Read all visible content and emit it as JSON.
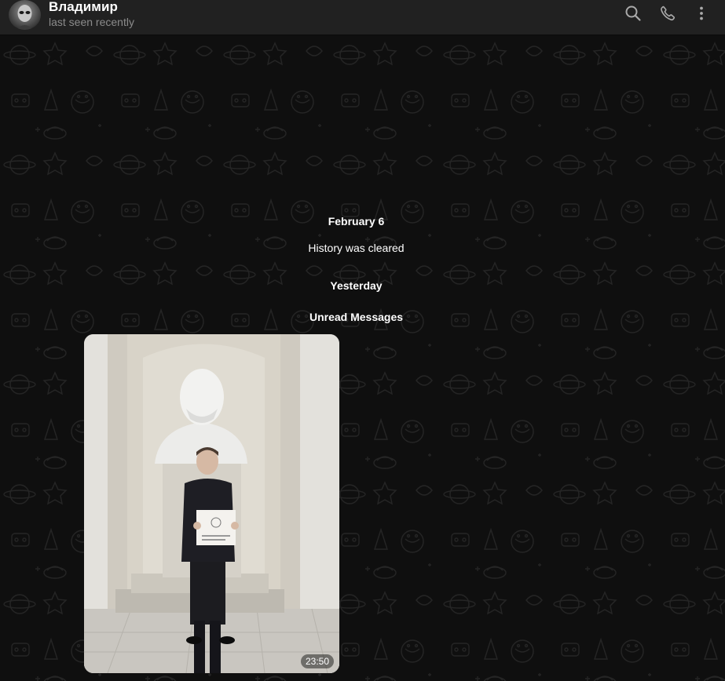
{
  "header": {
    "name": "Владимир",
    "status": "last seen recently",
    "icons": [
      "search-icon",
      "phone-icon",
      "more-vertical-icon"
    ]
  },
  "messages": {
    "date_1": "February 6",
    "history_cleared": "History was cleared",
    "date_2": "Yesterday",
    "unread_label": "Unread Messages",
    "photo_time": "23:50"
  },
  "colors": {
    "header_bg": "#212121",
    "chat_bg": "#0f0f0f",
    "name_text": "#ffffff",
    "status_text": "#8b8b8b"
  }
}
